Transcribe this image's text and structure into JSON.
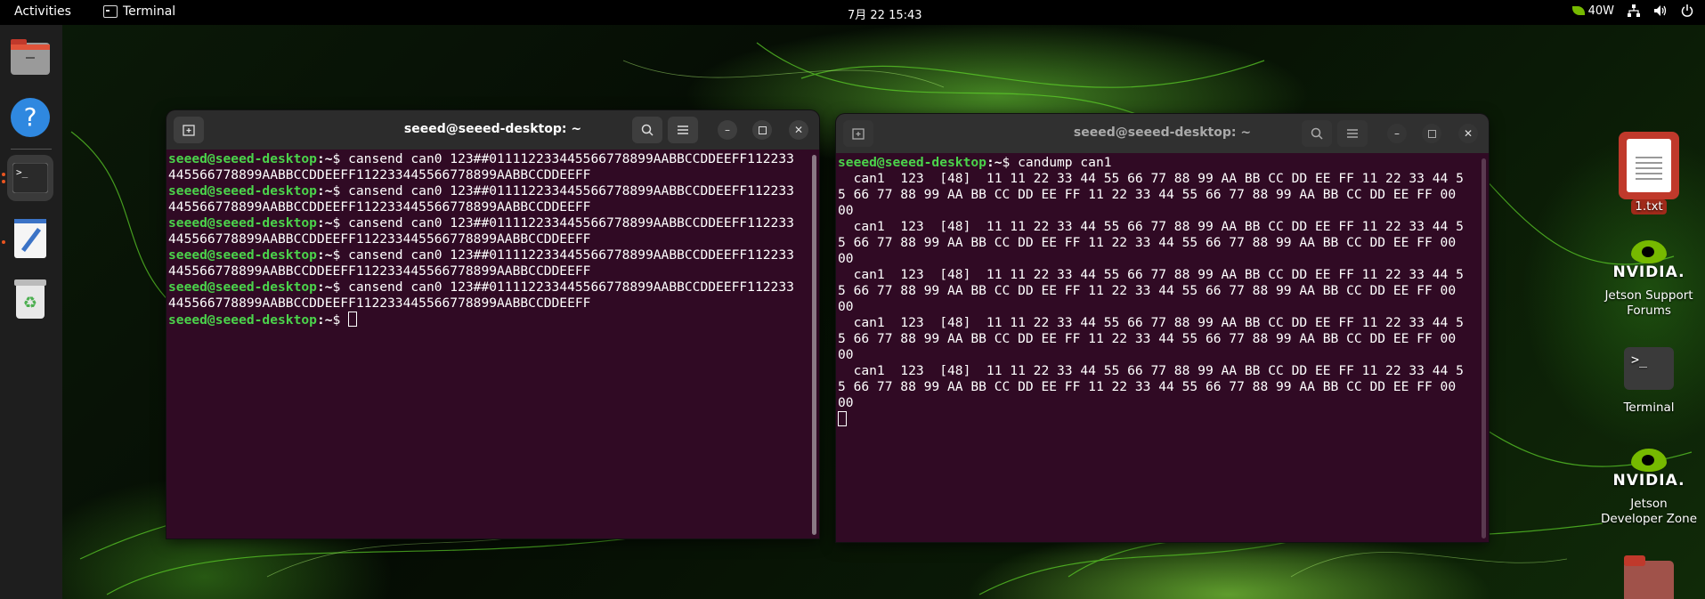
{
  "topbar": {
    "activities": "Activities",
    "app_name": "Terminal",
    "clock": "7月 22  15:43",
    "power_label": "40W"
  },
  "dock": {
    "items": [
      {
        "name": "files-icon"
      },
      {
        "name": "help-icon"
      },
      {
        "name": "terminal-icon"
      },
      {
        "name": "text-editor-icon"
      },
      {
        "name": "trash-icon"
      }
    ]
  },
  "windows": [
    {
      "title": "seeed@seeed-desktop: ~",
      "lines": [
        {
          "user": "seeed@seeed-desktop",
          "path": ":~",
          "cmd": "$ cansend can0 123##011112233445566778899AABBCCDDEEFF112233"
        },
        {
          "text": "445566778899AABBCCDDEEFF112233445566778899AABBCCDDEEFF"
        },
        {
          "user": "seeed@seeed-desktop",
          "path": ":~",
          "cmd": "$ cansend can0 123##011112233445566778899AABBCCDDEEFF112233"
        },
        {
          "text": "445566778899AABBCCDDEEFF112233445566778899AABBCCDDEEFF"
        },
        {
          "user": "seeed@seeed-desktop",
          "path": ":~",
          "cmd": "$ cansend can0 123##011112233445566778899AABBCCDDEEFF112233"
        },
        {
          "text": "445566778899AABBCCDDEEFF112233445566778899AABBCCDDEEFF"
        },
        {
          "user": "seeed@seeed-desktop",
          "path": ":~",
          "cmd": "$ cansend can0 123##011112233445566778899AABBCCDDEEFF112233"
        },
        {
          "text": "445566778899AABBCCDDEEFF112233445566778899AABBCCDDEEFF"
        },
        {
          "user": "seeed@seeed-desktop",
          "path": ":~",
          "cmd": "$ cansend can0 123##011112233445566778899AABBCCDDEEFF112233"
        },
        {
          "text": "445566778899AABBCCDDEEFF112233445566778899AABBCCDDEEFF"
        },
        {
          "user": "seeed@seeed-desktop",
          "path": ":~",
          "cmd": "$ ",
          "cursor": true
        }
      ]
    },
    {
      "title": "seeed@seeed-desktop: ~",
      "lines": [
        {
          "user": "seeed@seeed-desktop",
          "path": ":~",
          "cmd": "$ candump can1"
        },
        {
          "text": "  can1  123  [48]  11 11 22 33 44 55 66 77 88 99 AA BB CC DD EE FF 11 22 33 44 5"
        },
        {
          "text": "5 66 77 88 99 AA BB CC DD EE FF 11 22 33 44 55 66 77 88 99 AA BB CC DD EE FF 00"
        },
        {
          "text": "00"
        },
        {
          "text": "  can1  123  [48]  11 11 22 33 44 55 66 77 88 99 AA BB CC DD EE FF 11 22 33 44 5"
        },
        {
          "text": "5 66 77 88 99 AA BB CC DD EE FF 11 22 33 44 55 66 77 88 99 AA BB CC DD EE FF 00"
        },
        {
          "text": "00"
        },
        {
          "text": "  can1  123  [48]  11 11 22 33 44 55 66 77 88 99 AA BB CC DD EE FF 11 22 33 44 5"
        },
        {
          "text": "5 66 77 88 99 AA BB CC DD EE FF 11 22 33 44 55 66 77 88 99 AA BB CC DD EE FF 00"
        },
        {
          "text": "00"
        },
        {
          "text": "  can1  123  [48]  11 11 22 33 44 55 66 77 88 99 AA BB CC DD EE FF 11 22 33 44 5"
        },
        {
          "text": "5 66 77 88 99 AA BB CC DD EE FF 11 22 33 44 55 66 77 88 99 AA BB CC DD EE FF 00"
        },
        {
          "text": "00"
        },
        {
          "text": "  can1  123  [48]  11 11 22 33 44 55 66 77 88 99 AA BB CC DD EE FF 11 22 33 44 5"
        },
        {
          "text": "5 66 77 88 99 AA BB CC DD EE FF 11 22 33 44 55 66 77 88 99 AA BB CC DD EE FF 00"
        },
        {
          "text": "00"
        },
        {
          "text": "",
          "cursor": true
        }
      ]
    }
  ],
  "desktop": {
    "file_label": "1.txt",
    "jetson_forums_label": "Jetson Support Forums",
    "terminal_label": "Terminal",
    "jetson_zone_label": "Jetson Developer Zone",
    "nvidia_text": "NVIDIA."
  },
  "colors": {
    "terminal_bg": "#300a24",
    "prompt_user": "#4bd34b",
    "accent": "#e95420",
    "nvidia_green": "#76b900"
  }
}
